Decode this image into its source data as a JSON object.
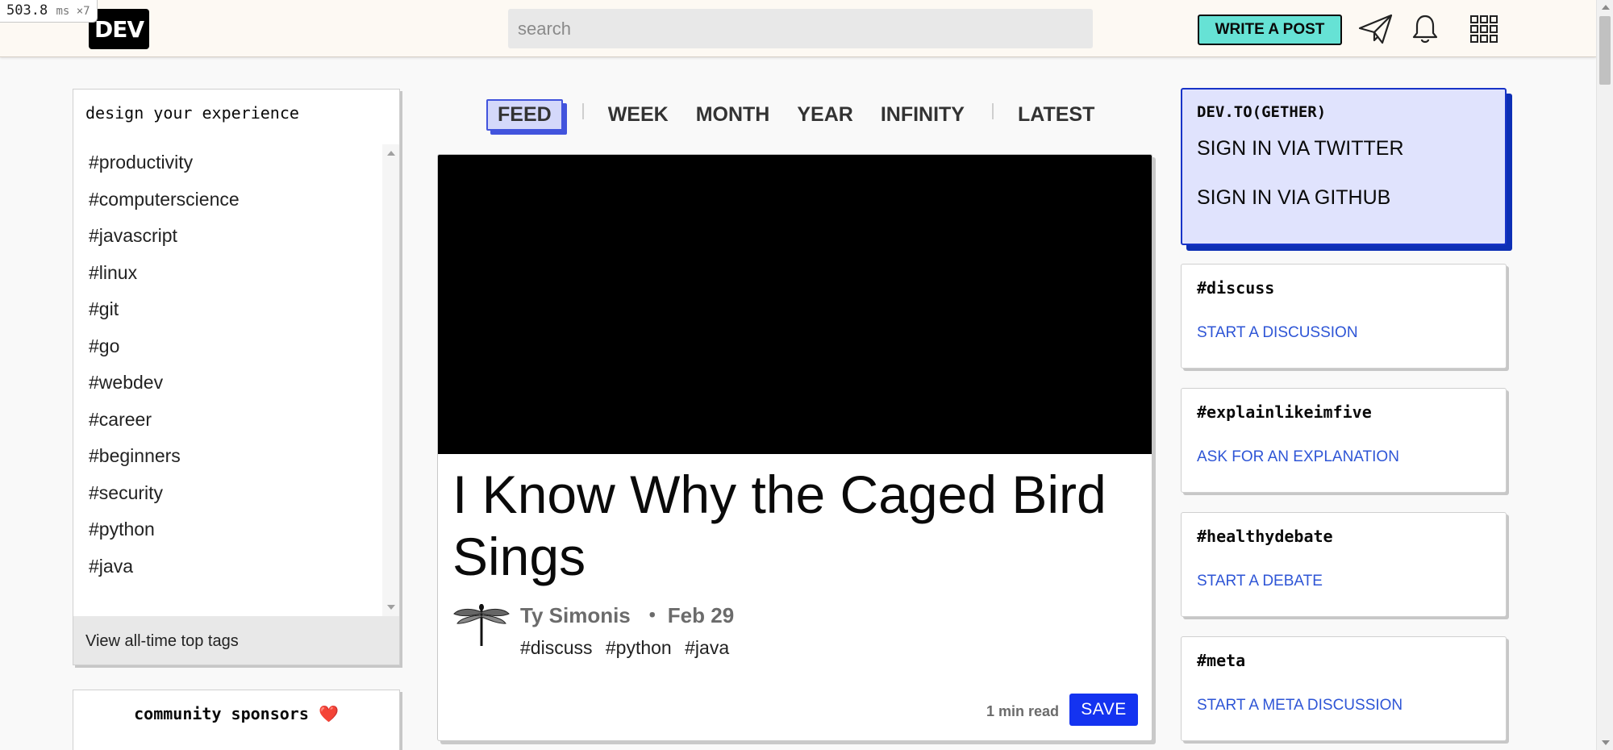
{
  "perf": {
    "value": "503.8",
    "unit": "ms ×7"
  },
  "header": {
    "logo": "DEV",
    "search_placeholder": "search",
    "write_post": "WRITE A POST"
  },
  "icons": {
    "send": "paper-plane-icon",
    "notifications": "bell-icon",
    "menu": "grid-icon"
  },
  "left_sidebar": {
    "heading": "design your experience",
    "tags": [
      "#productivity",
      "#computerscience",
      "#javascript",
      "#linux",
      "#git",
      "#go",
      "#webdev",
      "#career",
      "#beginners",
      "#security",
      "#python",
      "#java"
    ],
    "footer_link": "View all-time top tags",
    "sponsors_title": "community sponsors",
    "sponsors_heart": "❤️"
  },
  "feed_nav": {
    "feed": "FEED",
    "week": "WEEK",
    "month": "MONTH",
    "year": "YEAR",
    "infinity": "INFINITY",
    "latest": "LATEST"
  },
  "article": {
    "title": "I Know Why the Caged Bird Sings",
    "author": "Ty Simonis",
    "date": "Feb 29",
    "tags": [
      "#discuss",
      "#python",
      "#java"
    ],
    "read_time": "1 min read",
    "save": "SAVE"
  },
  "right_sidebar": {
    "gether": {
      "title": "DEV.TO(GETHER)",
      "twitter": "SIGN IN VIA TWITTER",
      "github": "SIGN IN VIA GITHUB"
    },
    "cards": [
      {
        "tag": "#discuss",
        "cta": "START A DISCUSSION"
      },
      {
        "tag": "#explainlikeimfive",
        "cta": "ASK FOR AN EXPLANATION"
      },
      {
        "tag": "#healthydebate",
        "cta": "START A DEBATE"
      },
      {
        "tag": "#meta",
        "cta": "START A META DISCUSSION"
      }
    ]
  },
  "colors": {
    "write_button": "#66e2d5",
    "active_tab": "#4254dd",
    "save_button": "#1433f0",
    "link_blue": "#2e55d6",
    "gether_bg": "#e0e3fd"
  }
}
